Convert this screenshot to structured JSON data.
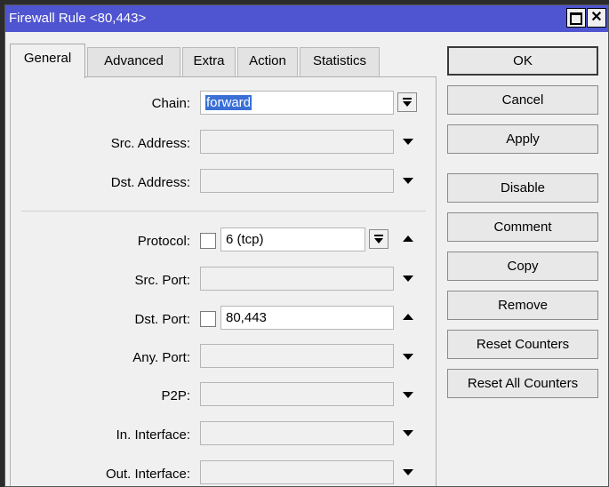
{
  "window": {
    "title": "Firewall Rule <80,443>"
  },
  "tabs": [
    "General",
    "Advanced",
    "Extra",
    "Action",
    "Statistics"
  ],
  "form": {
    "chain_label": "Chain:",
    "chain_value": "forward",
    "src_address_label": "Src. Address:",
    "src_address_value": "",
    "dst_address_label": "Dst. Address:",
    "dst_address_value": "",
    "protocol_label": "Protocol:",
    "protocol_value": "6 (tcp)",
    "src_port_label": "Src. Port:",
    "src_port_value": "",
    "dst_port_label": "Dst. Port:",
    "dst_port_value": "80,443",
    "any_port_label": "Any. Port:",
    "any_port_value": "",
    "p2p_label": "P2P:",
    "p2p_value": "",
    "in_interface_label": "In. Interface:",
    "in_interface_value": "",
    "out_interface_label": "Out. Interface:",
    "out_interface_value": ""
  },
  "buttons": {
    "ok": "OK",
    "cancel": "Cancel",
    "apply": "Apply",
    "disable": "Disable",
    "comment": "Comment",
    "copy": "Copy",
    "remove": "Remove",
    "reset_counters": "Reset Counters",
    "reset_all_counters": "Reset All Counters"
  },
  "colors": {
    "titlebar": "#4f54d0",
    "selection": "#3a6fd6"
  }
}
